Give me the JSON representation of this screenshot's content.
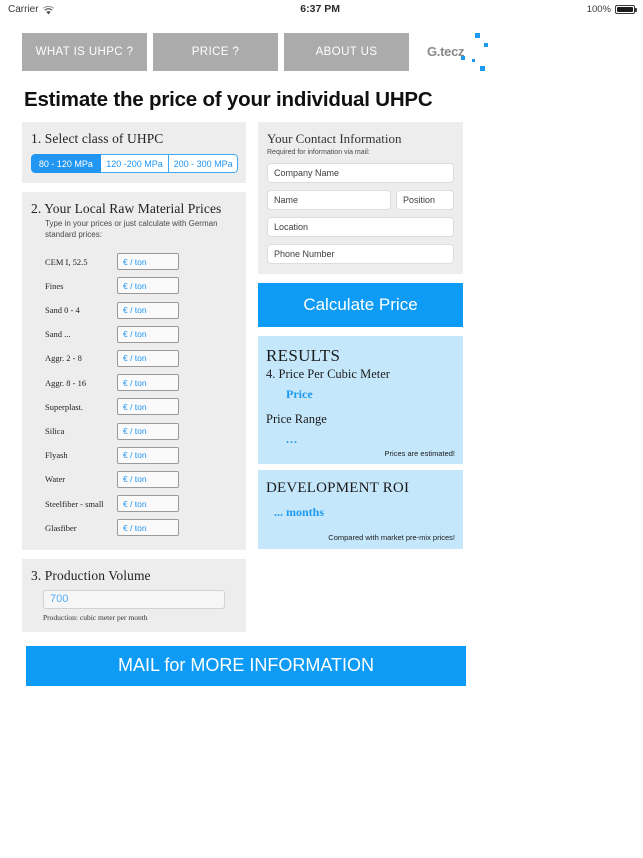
{
  "statusbar": {
    "carrier": "Carrier",
    "wifi_icon": "wifi-icon",
    "time": "6:37 PM",
    "battery_pct": "100%",
    "battery_icon": "battery-icon"
  },
  "nav": {
    "items": [
      {
        "label": "WHAT IS UHPC ?"
      },
      {
        "label": "PRICE ?"
      },
      {
        "label": "ABOUT US"
      }
    ],
    "logo": {
      "text": "G.tecz",
      "accent_color": "#1d9bf0"
    }
  },
  "page": {
    "title": "Estimate the price of your individual UHPC"
  },
  "section_class": {
    "title": "1. Select class of UHPC",
    "options": [
      {
        "label": "80 - 120 MPa",
        "selected": true
      },
      {
        "label": "120 -200 MPa",
        "selected": false
      },
      {
        "label": "200 - 300 MPa",
        "selected": false
      }
    ]
  },
  "section_materials": {
    "title": "2. Your Local Raw Material Prices",
    "subtitle": "Type in your prices or just calculate with German standard prices:",
    "unit_placeholder": "€ / ton",
    "rows": [
      {
        "label": "CEM I, 52.5",
        "value": "",
        "placeholder": "€ / ton"
      },
      {
        "label": "Fines",
        "value": "",
        "placeholder": "€ / ton"
      },
      {
        "label": "Sand 0 - 4",
        "value": "",
        "placeholder": "€ / ton"
      },
      {
        "label": "Sand ...",
        "value": "",
        "placeholder": "€ / ton"
      },
      {
        "label": "Aggr. 2 - 8",
        "value": "",
        "placeholder": "€ / ton"
      },
      {
        "label": "Aggr. 8 - 16",
        "value": "",
        "placeholder": "€ / ton"
      },
      {
        "label": "Superplast.",
        "value": "",
        "placeholder": "€ / ton"
      },
      {
        "label": "Silica",
        "value": "",
        "placeholder": "€ / ton"
      },
      {
        "label": "Flyash",
        "value": "",
        "placeholder": "€ / ton"
      },
      {
        "label": "Water",
        "value": "",
        "placeholder": "€ / ton"
      },
      {
        "label": "Steelfiber - small",
        "value": "",
        "placeholder": "€ / ton"
      },
      {
        "label": "Glasfiber",
        "value": "",
        "placeholder": "€ / ton"
      }
    ]
  },
  "section_volume": {
    "title": "3. Production Volume",
    "value": "700",
    "note": "Production: cubic meter per month"
  },
  "contact": {
    "title": "Your Contact Information",
    "subtitle": "Required for information via mail:",
    "fields": {
      "company": "Company Name",
      "name": "Name",
      "position": "Position",
      "location": "Location",
      "phone": "Phone Number"
    }
  },
  "calculate": {
    "label": "Calculate Price"
  },
  "results": {
    "title": "RESULTS",
    "subtitle": "4. Price Per Cubic Meter",
    "price_value": "Price",
    "price_range_label": "Price Range",
    "price_range_value": "...",
    "note": "Prices are estimated!"
  },
  "roi": {
    "title": "DEVELOPMENT ROI",
    "value": "... months",
    "note": "Compared with market pre-mix prices!"
  },
  "mail_button": {
    "label": "MAIL for MORE INFORMATION"
  }
}
